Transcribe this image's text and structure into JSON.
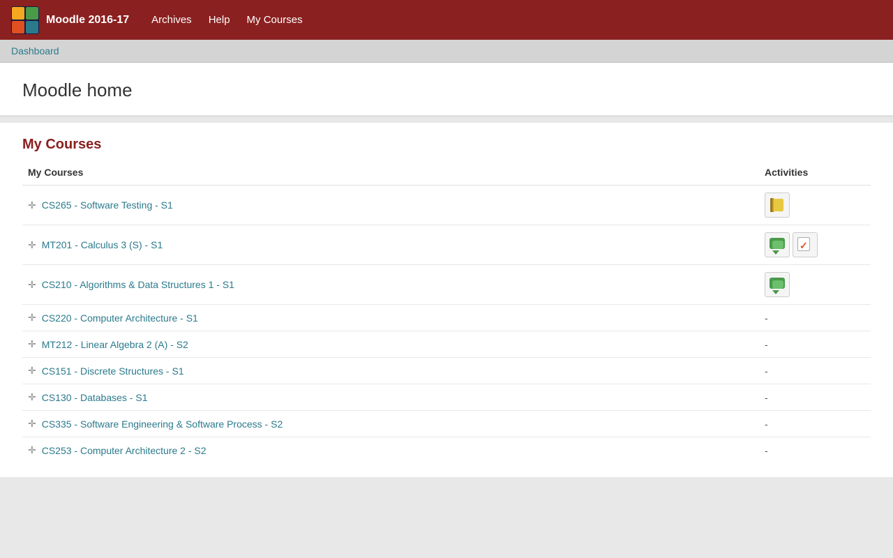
{
  "header": {
    "site_title": "Moodle 2016-17",
    "nav": [
      {
        "label": "Archives",
        "id": "archives"
      },
      {
        "label": "Help",
        "id": "help"
      },
      {
        "label": "My Courses",
        "id": "my-courses-nav"
      }
    ]
  },
  "breadcrumb": {
    "label": "Dashboard"
  },
  "page": {
    "title": "Moodle home"
  },
  "courses_section": {
    "heading": "My Courses",
    "col_courses": "My Courses",
    "col_activities": "Activities",
    "courses": [
      {
        "id": "cs265",
        "label": "CS265 - Software Testing - S1",
        "activities": "book"
      },
      {
        "id": "mt201",
        "label": "MT201 - Calculus 3 (S) - S1",
        "activities": "forum+assign"
      },
      {
        "id": "cs210",
        "label": "CS210 - Algorithms & Data Structures 1 - S1",
        "activities": "forum"
      },
      {
        "id": "cs220",
        "label": "CS220 - Computer Architecture - S1",
        "activities": "none"
      },
      {
        "id": "mt212",
        "label": "MT212 - Linear Algebra 2 (A) - S2",
        "activities": "none"
      },
      {
        "id": "cs151",
        "label": "CS151 - Discrete Structures - S1",
        "activities": "none"
      },
      {
        "id": "cs130",
        "label": "CS130 - Databases - S1",
        "activities": "none"
      },
      {
        "id": "cs335",
        "label": "CS335 - Software Engineering & Software Process - S2",
        "activities": "none"
      },
      {
        "id": "cs253",
        "label": "CS253 - Computer Architecture 2 - S2",
        "activities": "none"
      }
    ]
  }
}
